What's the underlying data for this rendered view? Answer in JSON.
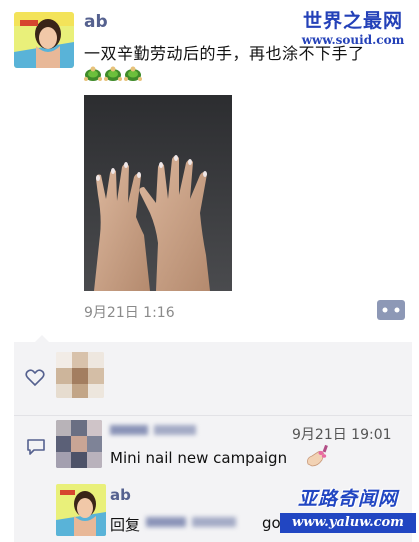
{
  "post": {
    "username": "ab",
    "text": "一双辛勤劳动后的手，再也涂不下手了",
    "emoji_count": 3,
    "time": "9月21日 1:16"
  },
  "comments": {
    "comment": {
      "time": "9月21日 19:01",
      "text": "Mini nail new campaign"
    },
    "reply": {
      "author": "ab",
      "prefix": "回复",
      "text": "good"
    }
  },
  "watermarks": {
    "top_title": "世界之最网",
    "top_url": "www.souid.com",
    "bottom_title": "亚路奇闻网",
    "bottom_url": "www.yaluw.com"
  },
  "colors": {
    "name_blue": "#55618f",
    "comment_bg": "#f3f3f5",
    "time_gray": "#8a8a8a",
    "watermark_blue": "#2146c2"
  }
}
